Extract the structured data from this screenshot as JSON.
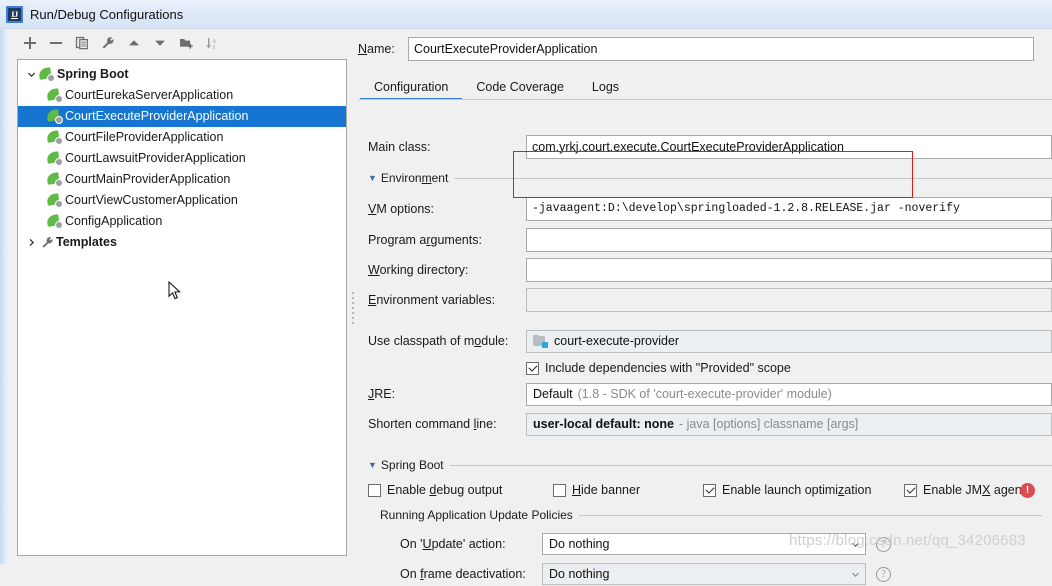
{
  "window": {
    "title": "Run/Debug Configurations",
    "logo_icon": "intellij-idea-logo-icon"
  },
  "toolbar": {
    "buttons": [
      {
        "name": "add-configuration-button",
        "icon": "plus-icon",
        "label": "+"
      },
      {
        "name": "remove-configuration-button",
        "icon": "minus-icon",
        "label": "−"
      },
      {
        "name": "copy-configuration-button",
        "icon": "copy-icon",
        "label": "Copy"
      },
      {
        "name": "edit-templates-button",
        "icon": "wrench-icon",
        "label": "Edit Templates"
      },
      {
        "name": "move-up-button",
        "icon": "arrow-up-icon",
        "label": "Move Up"
      },
      {
        "name": "move-down-button",
        "icon": "arrow-down-icon",
        "label": "Move Down"
      },
      {
        "name": "create-folder-button",
        "icon": "new-folder-icon",
        "label": "Create Folder"
      },
      {
        "name": "sort-configurations-button",
        "icon": "sort-alphabetically-icon",
        "label": "Sort"
      }
    ]
  },
  "tree": {
    "group": {
      "label": "Spring Boot",
      "expanded": true,
      "twisty_icon": "chevron-down-icon",
      "icon": "spring-boot-icon"
    },
    "items": [
      {
        "label": "CourtEurekaServerApplication",
        "icon": "spring-boot-icon",
        "selected": false
      },
      {
        "label": "CourtExecuteProviderApplication",
        "icon": "spring-boot-icon",
        "selected": true
      },
      {
        "label": "CourtFileProviderApplication",
        "icon": "spring-boot-icon",
        "selected": false
      },
      {
        "label": "CourtLawsuitProviderApplication",
        "icon": "spring-boot-icon",
        "selected": false
      },
      {
        "label": "CourtMainProviderApplication",
        "icon": "spring-boot-icon",
        "selected": false
      },
      {
        "label": "CourtViewCustomerApplication",
        "icon": "spring-boot-icon",
        "selected": false
      },
      {
        "label": "ConfigApplication",
        "icon": "spring-boot-icon",
        "selected": false
      }
    ],
    "templates": {
      "label": "Templates",
      "expanded": false,
      "twisty_icon": "chevron-right-icon",
      "icon": "wrench-icon"
    }
  },
  "name_row": {
    "label": "Name:",
    "value": "CourtExecuteProviderApplication",
    "placeholder": ""
  },
  "tabs": [
    {
      "label": "Configuration",
      "active": true
    },
    {
      "label": "Code Coverage",
      "active": false
    },
    {
      "label": "Logs",
      "active": false
    }
  ],
  "config": {
    "main_class": {
      "label": "Main class:",
      "value": "com.yrkj.court.execute.CourtExecuteProviderApplication"
    },
    "environment_separator": {
      "label": "Environment",
      "arrow_icon": "triangle-down-icon"
    },
    "vm_options": {
      "label": "VM options:",
      "value": "-javaagent:D:\\develop\\springloaded-1.2.8.RELEASE.jar -noverify"
    },
    "program_arguments": {
      "label": "Program arguments:",
      "value": ""
    },
    "working_directory": {
      "label": "Working directory:",
      "value": ""
    },
    "environment_variables": {
      "label": "Environment variables:",
      "value": "",
      "disabled": true
    },
    "use_classpath_of_module": {
      "label": "Use classpath of module:",
      "value": "court-execute-provider",
      "icon": "module-icon"
    },
    "include_provided": {
      "label": "Include dependencies with \"Provided\" scope",
      "checked": true
    },
    "jre": {
      "label": "JRE:",
      "value": "Default",
      "hint": "(1.8 - SDK of 'court-execute-provider' module)"
    },
    "shorten_command_line": {
      "label": "Shorten command line:",
      "value": "user-local default: none",
      "hint": "- java [options] classname [args]"
    }
  },
  "spring_boot_section": {
    "separator_label": "Spring Boot",
    "arrow_icon": "triangle-down-icon",
    "checkboxes": [
      {
        "label": "Enable debug output",
        "checked": false,
        "name": "enable-debug-output-checkbox"
      },
      {
        "label": "Hide banner",
        "checked": false,
        "name": "hide-banner-checkbox"
      },
      {
        "label": "Enable launch optimization",
        "checked": true,
        "name": "enable-launch-optimization-checkbox"
      },
      {
        "label": "Enable JMX agent",
        "checked": true,
        "name": "enable-jmx-agent-checkbox"
      }
    ],
    "error_icon": "error-exclamation-icon",
    "update_policies": {
      "separator_label": "Running Application Update Policies",
      "on_update_action": {
        "label": "On 'Update' action:",
        "value": "Do nothing",
        "help_icon": "help-question-icon"
      },
      "on_frame_deactivation": {
        "label": "On frame deactivation:",
        "value": "Do nothing",
        "help_icon": "help-question-icon"
      }
    }
  },
  "annotation": {
    "color": "#e01b1b",
    "target": "vm-options-field"
  },
  "watermark": {
    "text": "https://blog.csdn.net/qq_34206683"
  },
  "colors": {
    "selection": "#1675d1",
    "tab_accent": "#3c7fd4",
    "spring_green": "#5fbb46",
    "error_red": "#dd4b50"
  }
}
